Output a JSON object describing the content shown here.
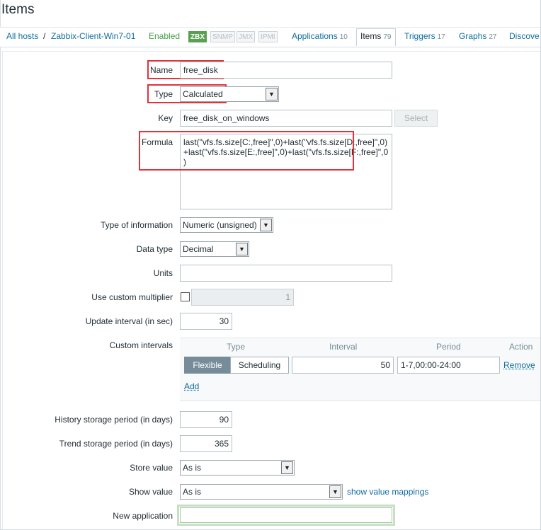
{
  "page_title": "Items",
  "breadcrumb": {
    "all_hosts": "All hosts",
    "separator": "/",
    "host": "Zabbix-Client-Win7-01",
    "status": "Enabled",
    "badges": [
      "ZBX",
      "SNMP",
      "JMX",
      "IPMI"
    ]
  },
  "nav_tabs": [
    {
      "label": "Applications",
      "count": "10"
    },
    {
      "label": "Items",
      "count": "79"
    },
    {
      "label": "Triggers",
      "count": "17"
    },
    {
      "label": "Graphs",
      "count": "27"
    },
    {
      "label": "Discove",
      "count": ""
    }
  ],
  "form": {
    "name": {
      "label": "Name",
      "value": "free_disk"
    },
    "type": {
      "label": "Type",
      "value": "Calculated"
    },
    "key": {
      "label": "Key",
      "value": "free_disk_on_windows",
      "select_button": "Select"
    },
    "formula": {
      "label": "Formula",
      "value": "last(\"vfs.fs.size[C:,free]\",0)+last(\"vfs.fs.size[D:,free]\",0)+last(\"vfs.fs.size[E:,free]\",0)+last(\"vfs.fs.size[F:,free]\",0)"
    },
    "type_of_information": {
      "label": "Type of information",
      "value": "Numeric (unsigned)"
    },
    "data_type": {
      "label": "Data type",
      "value": "Decimal"
    },
    "units": {
      "label": "Units",
      "value": ""
    },
    "custom_multiplier": {
      "label": "Use custom multiplier",
      "value": "1",
      "checked": false
    },
    "update_interval": {
      "label": "Update interval (in sec)",
      "value": "30"
    },
    "custom_intervals": {
      "label": "Custom intervals",
      "headers": {
        "type": "Type",
        "interval": "Interval",
        "period": "Period",
        "action": "Action"
      },
      "row": {
        "flexible": "Flexible",
        "scheduling": "Scheduling",
        "interval": "50",
        "period": "1-7,00:00-24:00",
        "remove": "Remove"
      },
      "add": "Add"
    },
    "history": {
      "label": "History storage period (in days)",
      "value": "90"
    },
    "trend": {
      "label": "Trend storage period (in days)",
      "value": "365"
    },
    "store_value": {
      "label": "Store value",
      "value": "As is"
    },
    "show_value": {
      "label": "Show value",
      "value": "As is",
      "mappings_link": "show value mappings"
    },
    "new_application": {
      "label": "New application",
      "value": ""
    }
  },
  "colors": {
    "link": "#0f6d9e",
    "highlight": "#e0333a",
    "enabled": "#429e47",
    "zbx_badge": "#59a150"
  }
}
